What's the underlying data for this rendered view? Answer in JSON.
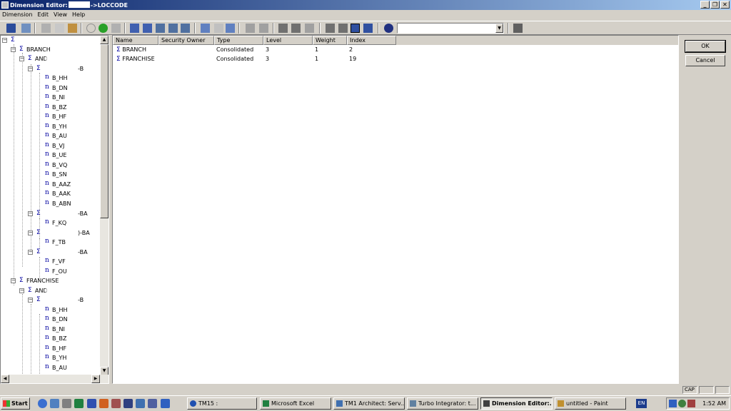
{
  "window": {
    "title_prefix": "Dimension Editor:",
    "title_suffix": "->LOCCODE",
    "minimize": "_",
    "maximize": "❐",
    "close": "✕"
  },
  "menu": [
    "Dimension",
    "Edit",
    "View",
    "Help"
  ],
  "tree": {
    "root_label": "",
    "rows": [
      {
        "label": "BRANCH"
      },
      {
        "label": "AND"
      },
      {
        "label": "-B"
      },
      {
        "label": "B_HH"
      },
      {
        "label": "B_DN"
      },
      {
        "label": "B_NI"
      },
      {
        "label": "B_BZ"
      },
      {
        "label": "B_HF"
      },
      {
        "label": "B_YH"
      },
      {
        "label": "B_AU"
      },
      {
        "label": "B_VJ"
      },
      {
        "label": "B_UE"
      },
      {
        "label": "B_VQ"
      },
      {
        "label": "B_SN"
      },
      {
        "label": "B_AAZ"
      },
      {
        "label": "B_AAK"
      },
      {
        "label": "B_ABN"
      },
      {
        "label": "-BA"
      },
      {
        "label": "F_KQ"
      },
      {
        "label": ")-BA"
      },
      {
        "label": "F_TB"
      },
      {
        "label": "-BA"
      },
      {
        "label": "F_VF"
      },
      {
        "label": "F_OU"
      },
      {
        "label": "FRANCHISE"
      },
      {
        "label": "AND"
      },
      {
        "label": "-B"
      },
      {
        "label": "B_HH"
      },
      {
        "label": "B_DN"
      },
      {
        "label": "B_NI"
      },
      {
        "label": "B_BZ"
      },
      {
        "label": "B_HF"
      },
      {
        "label": "B_YH"
      },
      {
        "label": "B_AU"
      }
    ]
  },
  "grid": {
    "columns": [
      "Name",
      "Security Owner",
      "Type",
      "Level",
      "Weight",
      "Index"
    ],
    "rows": [
      {
        "name": "BRANCH",
        "owner": "",
        "type": "Consolidated",
        "level": "3",
        "weight": "1",
        "index": "2"
      },
      {
        "name": "FRANCHISE",
        "owner": "",
        "type": "Consolidated",
        "level": "3",
        "weight": "1",
        "index": "19"
      }
    ]
  },
  "buttons": {
    "ok": "OK",
    "cancel": "Cancel"
  },
  "status": {
    "cap": "CAP"
  },
  "taskbar": {
    "start": "Start",
    "tasks": [
      {
        "label": "TM15 :"
      },
      {
        "label": "Microsoft Excel"
      },
      {
        "label": "TM1 Architect: Serv..."
      },
      {
        "label": "Turbo Integrator: t..."
      },
      {
        "label": "Dimension Editor:..."
      },
      {
        "label": "untitled - Paint"
      }
    ],
    "lang": "EN",
    "clock": "1:52 AM"
  }
}
